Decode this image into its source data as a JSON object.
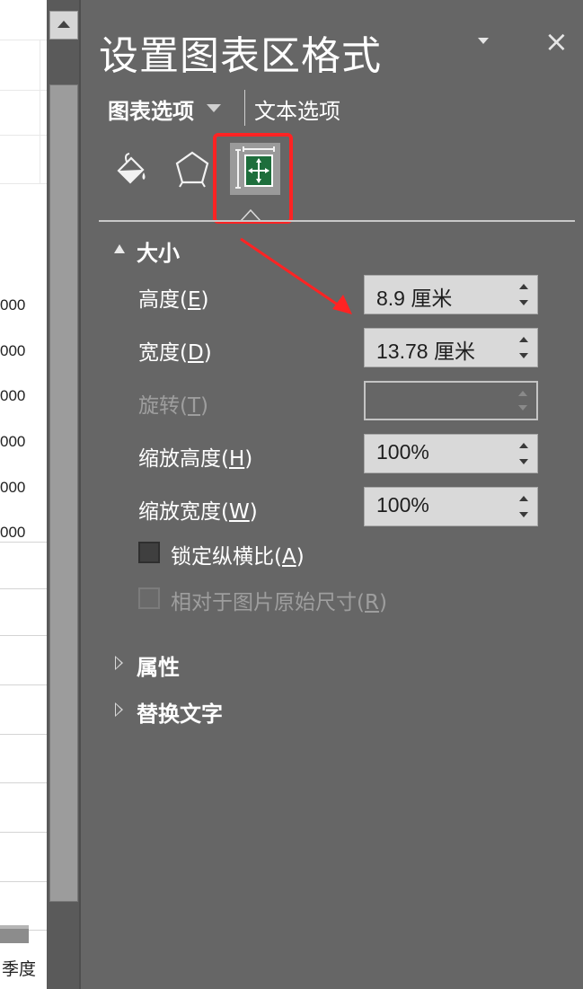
{
  "sheet": {
    "axis_labels": [
      "000",
      "000",
      "000",
      "000",
      "000",
      "000"
    ],
    "category_label": "季度"
  },
  "panel": {
    "title": "设置图表区格式",
    "tabs": {
      "chart_options": "图表选项",
      "text_options": "文本选项"
    },
    "icons": [
      "fill-line-icon",
      "effects-icon",
      "size-properties-icon"
    ],
    "highlight_color": "#ff2323",
    "section_size": {
      "title": "大小",
      "height": {
        "label": "高度(",
        "key": "E",
        "tail": ")",
        "value": "8.9 厘米"
      },
      "width": {
        "label": "宽度(",
        "key": "D",
        "tail": ")",
        "value": "13.78 厘米"
      },
      "rotation": {
        "label": "旋转(",
        "key": "T",
        "tail": ")",
        "value": ""
      },
      "scale_height": {
        "label": "缩放高度(",
        "key": "H",
        "tail": ")",
        "value": "100%"
      },
      "scale_width": {
        "label": "缩放宽度(",
        "key": "W",
        "tail": ")",
        "value": "100%"
      },
      "lock_aspect": {
        "label": "锁定纵横比(",
        "key": "A",
        "tail": ")"
      },
      "relative_original": {
        "label": "相对于图片原始尺寸(",
        "key": "R",
        "tail": ")"
      }
    },
    "section_properties": {
      "title": "属性"
    },
    "section_alt_text": {
      "title": "替换文字"
    }
  }
}
